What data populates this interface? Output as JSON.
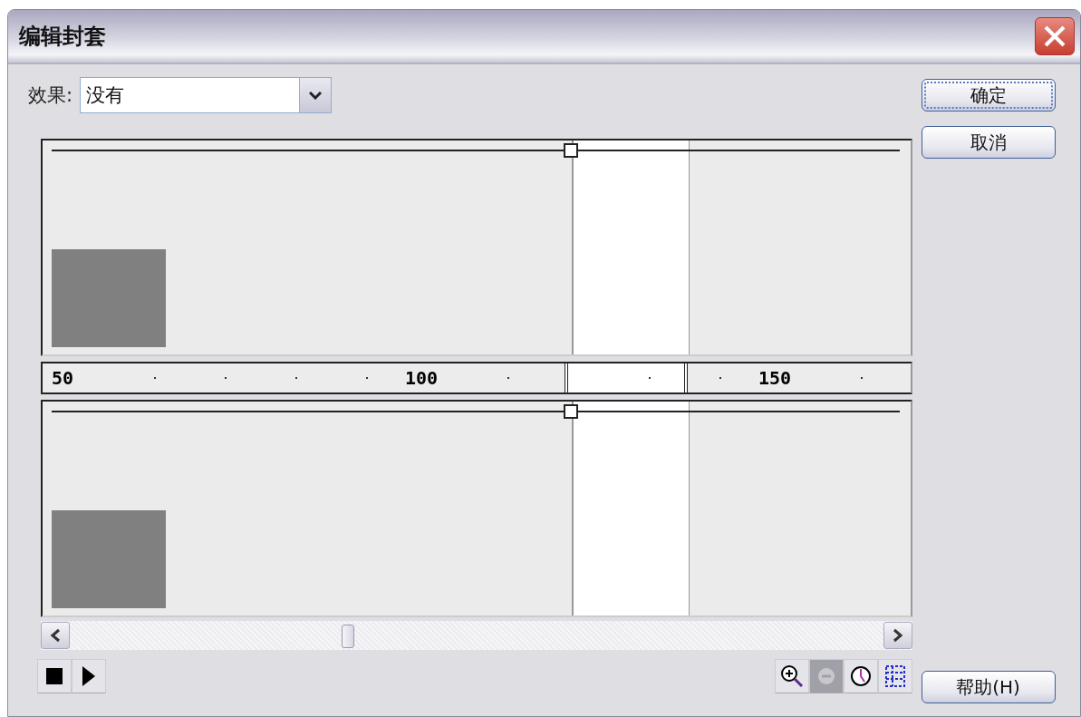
{
  "window": {
    "title": "编辑封套"
  },
  "effect": {
    "label": "效果:",
    "value": "没有"
  },
  "ruler": [
    {
      "kind": "label",
      "text": "50"
    },
    {
      "kind": "dot"
    },
    {
      "kind": "dot"
    },
    {
      "kind": "dot"
    },
    {
      "kind": "dot"
    },
    {
      "kind": "label",
      "text": "100"
    },
    {
      "kind": "dot"
    },
    {
      "kind": "dot"
    },
    {
      "kind": "dot"
    },
    {
      "kind": "label",
      "text": "150"
    },
    {
      "kind": "dot"
    }
  ],
  "scrollbar": {
    "level": 0.34
  },
  "playback": [
    {
      "kind": "stop"
    },
    {
      "kind": "play"
    }
  ],
  "tools": [
    {
      "kind": "zoom-in",
      "disabled": false
    },
    {
      "kind": "zoom-out",
      "disabled": true
    },
    {
      "kind": "time",
      "disabled": false
    },
    {
      "kind": "frames",
      "disabled": false
    }
  ],
  "buttons": [
    {
      "label": "确定",
      "default": true
    },
    {
      "label": "取消",
      "default": false
    }
  ],
  "help_button": {
    "label": "帮助(H)"
  }
}
